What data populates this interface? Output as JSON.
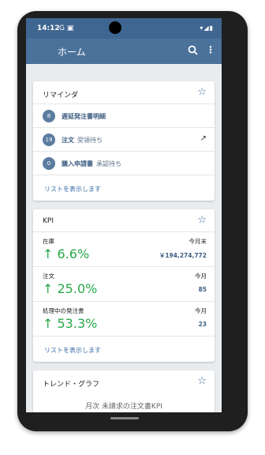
{
  "status": {
    "time": "14:12",
    "icons_left": "G ▣",
    "icons_right": "▾◢▮"
  },
  "appbar": {
    "title": "ホーム",
    "search_icon": "search-icon",
    "more": "⋮"
  },
  "reminders": {
    "title": "リマインダ",
    "items": [
      {
        "count": "8",
        "label": "遅延発注書明細",
        "sub": ""
      },
      {
        "count": "19",
        "label": "注文",
        "sub": "受領待ち",
        "ext": "↗"
      },
      {
        "count": "0",
        "label": "購入申請書",
        "sub": "承認待ち"
      }
    ],
    "link": "リストを表示します"
  },
  "kpi": {
    "title": "KPI",
    "items": [
      {
        "label": "在庫",
        "period": "今月末",
        "value": "↑ 6.6%",
        "amount": "￥194,274,772"
      },
      {
        "label": "注文",
        "period": "今月",
        "value": "↑ 25.0%",
        "amount": "85"
      },
      {
        "label": "処理中の発注書",
        "period": "今月",
        "value": "↑ 53.3%",
        "amount": "23"
      }
    ],
    "link": "リストを表示します"
  },
  "trend": {
    "title": "トレンド・グラフ",
    "subtitle": "月次 未請求の注文書KPI"
  },
  "colors": {
    "appbar": "#4b729b",
    "accent": "#3b6ea5",
    "positive": "#29a84a"
  }
}
